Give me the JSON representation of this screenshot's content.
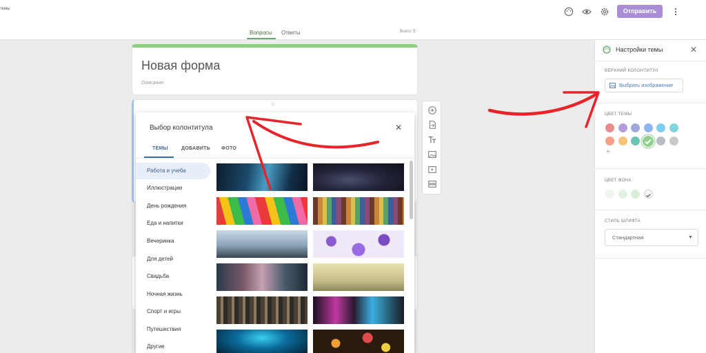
{
  "header": {
    "title_fragment": "темы",
    "send_label": "Отправить",
    "tabs": [
      {
        "label": "Вопросы"
      },
      {
        "label": "Ответы"
      }
    ],
    "total": "Всего: 5"
  },
  "form": {
    "title": "Новая форма",
    "description": "Описание"
  },
  "dialog": {
    "title": "Выбор колонтитула",
    "close": "✕",
    "tabs": [
      {
        "label": "ТЕМЫ"
      },
      {
        "label": "ДОБАВИТЬ"
      },
      {
        "label": "ФОТО"
      }
    ],
    "categories": [
      {
        "label": "Работа и учеба"
      },
      {
        "label": "Иллюстрации"
      },
      {
        "label": "День рождения"
      },
      {
        "label": "Еда и напитки"
      },
      {
        "label": "Вечеринка"
      },
      {
        "label": "Для детей"
      },
      {
        "label": "Свадьба"
      },
      {
        "label": "Ночная жизнь"
      },
      {
        "label": "Спорт и игры"
      },
      {
        "label": "Путешествия"
      },
      {
        "label": "Другие"
      }
    ]
  },
  "theme_panel": {
    "title": "Настройки темы",
    "close": "✕",
    "header_label": "ВЕРХНИЙ КОЛОНТИТУЛ",
    "choose_image": "Выбрать изображение",
    "theme_color_label": "ЦВЕТ ТЕМЫ",
    "theme_colors": [
      "#e88d8d",
      "#b39ddb",
      "#9fa8da",
      "#90b4ef",
      "#7ecfef",
      "#7fd6dd",
      "#f4a08a",
      "#f8c27a",
      "#6dc3b3",
      "#8fd08f",
      "#b8bec3",
      "#c9c9c9"
    ],
    "selected_theme_color": "#8fd08f",
    "bg_color_label": "ЦВЕТ ФОНА",
    "bg_colors": [
      "#eef6ee",
      "#e4f2e4",
      "#d9eed9",
      "#f7f7f7"
    ],
    "font_style_label": "СТИЛЬ ШРИФТА",
    "font_value": "Стандартная"
  },
  "colors": {
    "accent": "#a98ed6",
    "form_accent": "#8fcf84",
    "link": "#4a7ac0",
    "annotation": "#e8232a"
  }
}
